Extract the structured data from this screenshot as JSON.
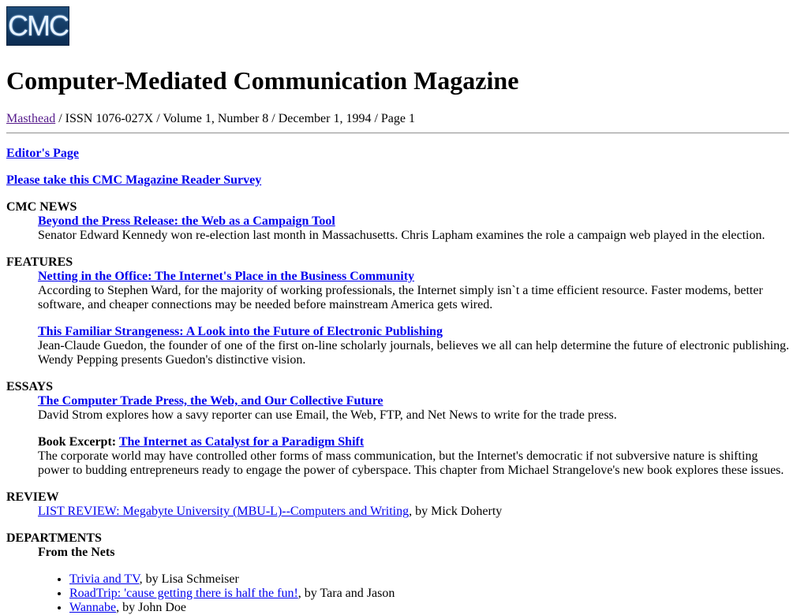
{
  "logo": {
    "text": "CMC"
  },
  "title": "Computer-Mediated Communication Magazine",
  "masthead_line": {
    "link": "Masthead",
    "rest": " / ISSN 1076-027X / Volume 1, Number 8 / December 1, 1994 / Page 1"
  },
  "editors_page": "Editor's Page",
  "survey": "Please take this CMC Magazine Reader Survey",
  "cmc_news": {
    "heading": "CMC NEWS",
    "items": [
      {
        "link": "Beyond the Press Release: the Web as a Campaign Tool",
        "desc": "Senator Edward Kennedy won re-election last month in Massachusetts. Chris Lapham examines the role a campaign web played in the election."
      }
    ]
  },
  "features": {
    "heading": "FEATURES",
    "items": [
      {
        "link": "Netting in the Office: The Internet's Place in the Business Community",
        "desc": "According to Stephen Ward, for the majority of working professionals, the Internet simply isn`t a time efficient resource. Faster modems, better software, and cheaper connections may be needed before mainstream America gets wired."
      },
      {
        "link": "This Familiar Strangeness: A Look into the Future of Electronic Publishing",
        "desc": "Jean-Claude Guedon, the founder of one of the first on-line scholarly journals, believes we all can help determine the future of electronic publishing. Wendy Pepping presents Guedon's distinctive vision."
      }
    ]
  },
  "essays": {
    "heading": "ESSAYS",
    "items": [
      {
        "link": "The Computer Trade Press, the Web, and Our Collective Future",
        "desc": "David Strom explores how a savy reporter can use Email, the Web, FTP, and Net News to write for the trade press."
      },
      {
        "prefix": "Book Excerpt: ",
        "link": "The Internet as Catalyst for a Paradigm Shift",
        "desc": "The corporate world may have controlled other forms of mass communication, but the Internet's democratic if not subversive nature is shifting power to budding entrepreneurs ready to engage the power of cyberspace. This chapter from Michael Strangelove's new book explores these issues."
      }
    ]
  },
  "review": {
    "heading": "REVIEW",
    "link": "LIST REVIEW: Megabyte University (MBU-L)--Computers and Writing",
    "suffix": ", by Mick Doherty"
  },
  "departments": {
    "heading": "DEPARTMENTS",
    "subheading": "From the Nets",
    "items": [
      {
        "link": "Trivia and TV",
        "suffix": ", by Lisa Schmeiser"
      },
      {
        "link": "RoadTrip: 'cause getting there is half the fun!",
        "suffix": ", by Tara and Jason"
      },
      {
        "link": "Wannabe",
        "suffix": ", by John Doe"
      }
    ]
  }
}
